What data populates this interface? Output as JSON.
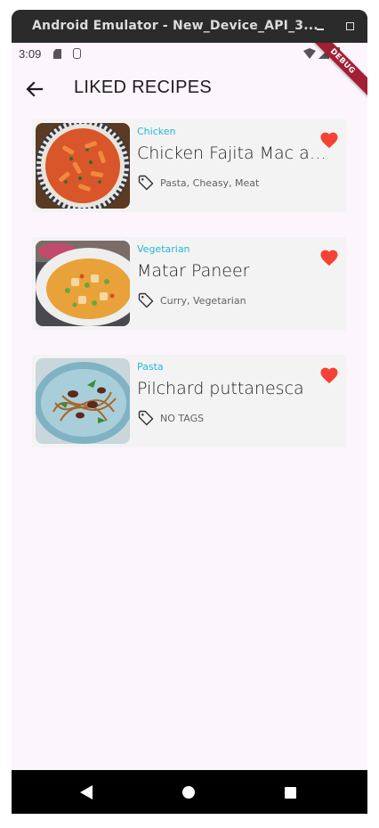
{
  "window": {
    "title": "Android Emulator - New_Device_API_3..."
  },
  "status_bar": {
    "time": "3:09"
  },
  "debug_banner": "DEBUG",
  "app_bar": {
    "title": "LIKED RECIPES"
  },
  "recipes": [
    {
      "category": "Chicken",
      "title": "Chicken Fajita Mac and Cheese",
      "tags": "Pasta, Cheasy, Meat",
      "liked": true
    },
    {
      "category": "Vegetarian",
      "title": "Matar Paneer",
      "tags": "Curry, Vegetarian",
      "liked": true
    },
    {
      "category": "Pasta",
      "title": "Pilchard puttanesca",
      "tags": "NO TAGS",
      "liked": true
    }
  ],
  "colors": {
    "accent_category": "#22b8d4",
    "heart": "#f44336",
    "screen_background": "#fcf5fc",
    "card_background": "#f4f3f4",
    "debug_banner": "#a31f34"
  },
  "icons": {
    "back": "arrow-left-icon",
    "tag": "tag-icon",
    "heart": "heart-icon",
    "nav_back": "triangle-back-icon",
    "nav_home": "circle-home-icon",
    "nav_recents": "square-recents-icon"
  }
}
